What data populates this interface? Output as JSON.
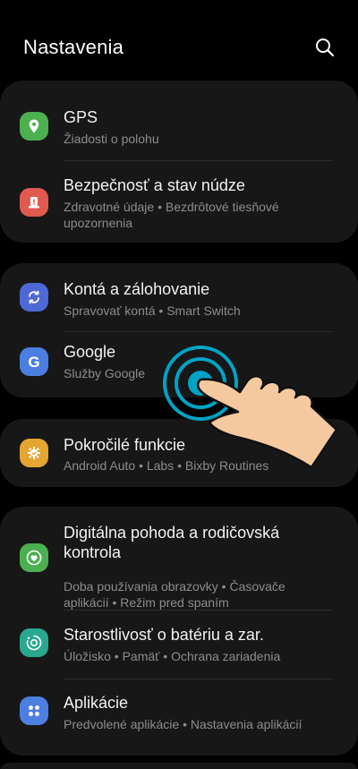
{
  "header": {
    "title": "Nastavenia"
  },
  "sections": [
    {
      "items": [
        {
          "title": "GPS",
          "subtitle": "Žiadosti o polohu",
          "icon": "location-pin-icon",
          "color": "#4caf50"
        },
        {
          "title": "Bezpečnosť a stav núdze",
          "subtitle": "Zdravotné údaje  •  Bezdrôtové tiesňové upozornenia",
          "icon": "emergency-alert-icon",
          "color": "#e05a4f"
        }
      ]
    },
    {
      "items": [
        {
          "title": "Kontá a zálohovanie",
          "subtitle": "Spravovať kontá  •  Smart Switch",
          "icon": "sync-icon",
          "color": "#4d69d6"
        },
        {
          "title": "Google",
          "subtitle": "Služby Google",
          "icon": "google-g-icon",
          "color": "#4a7ee0"
        }
      ]
    },
    {
      "items": [
        {
          "title": "Pokročilé funkcie",
          "subtitle": "Android Auto  •  Labs  •  Bixby Routines",
          "icon": "puzzle-gear-icon",
          "color": "#e5a533"
        }
      ]
    },
    {
      "items": [
        {
          "title": "Digitálna pohoda a rodičovská kontrola",
          "subtitle": "Doba používania obrazovky  •  Časovače aplikácií  •  Režim pred spaním",
          "icon": "wellbeing-heart-icon",
          "color": "#4caf50"
        },
        {
          "title": "Starostlivosť o batériu a zar.",
          "subtitle": "Úložisko  •  Pamäť  •  Ochrana zariadenia",
          "icon": "device-care-icon",
          "color": "#2aa88f"
        },
        {
          "title": "Aplikácie",
          "subtitle": "Predvolené aplikácie  •  Nastavenia aplikácií",
          "icon": "apps-grid-icon",
          "color": "#4d7fe0"
        }
      ]
    }
  ],
  "icons": {
    "search": "search-icon",
    "gesture": "tap-gesture-hand-icon"
  }
}
